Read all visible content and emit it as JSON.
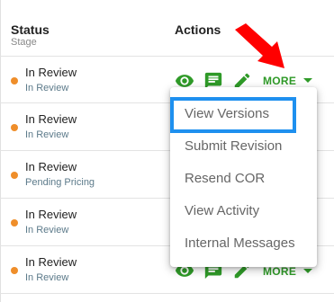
{
  "table": {
    "header_status": "Status",
    "header_stage": "Stage",
    "header_actions": "Actions",
    "rows": [
      {
        "status": "In Review",
        "stage": "In Review"
      },
      {
        "status": "In Review",
        "stage": "In Review"
      },
      {
        "status": "In Review",
        "stage": "Pending Pricing"
      },
      {
        "status": "In Review",
        "stage": "In Review"
      },
      {
        "status": "In Review",
        "stage": "In Review"
      }
    ]
  },
  "actions": {
    "more_label": "MORE",
    "view_icon": "eye-icon",
    "message_icon": "message-icon",
    "edit_icon": "pencil-icon"
  },
  "menu": {
    "items": [
      "View Versions",
      "Submit Revision",
      "Resend COR",
      "View Activity",
      "Internal Messages"
    ]
  },
  "colors": {
    "accent_green": "#2f9a28",
    "status_dot": "#ef8e2a",
    "highlight_blue": "#1e90ef",
    "arrow_red": "#ff0000"
  }
}
